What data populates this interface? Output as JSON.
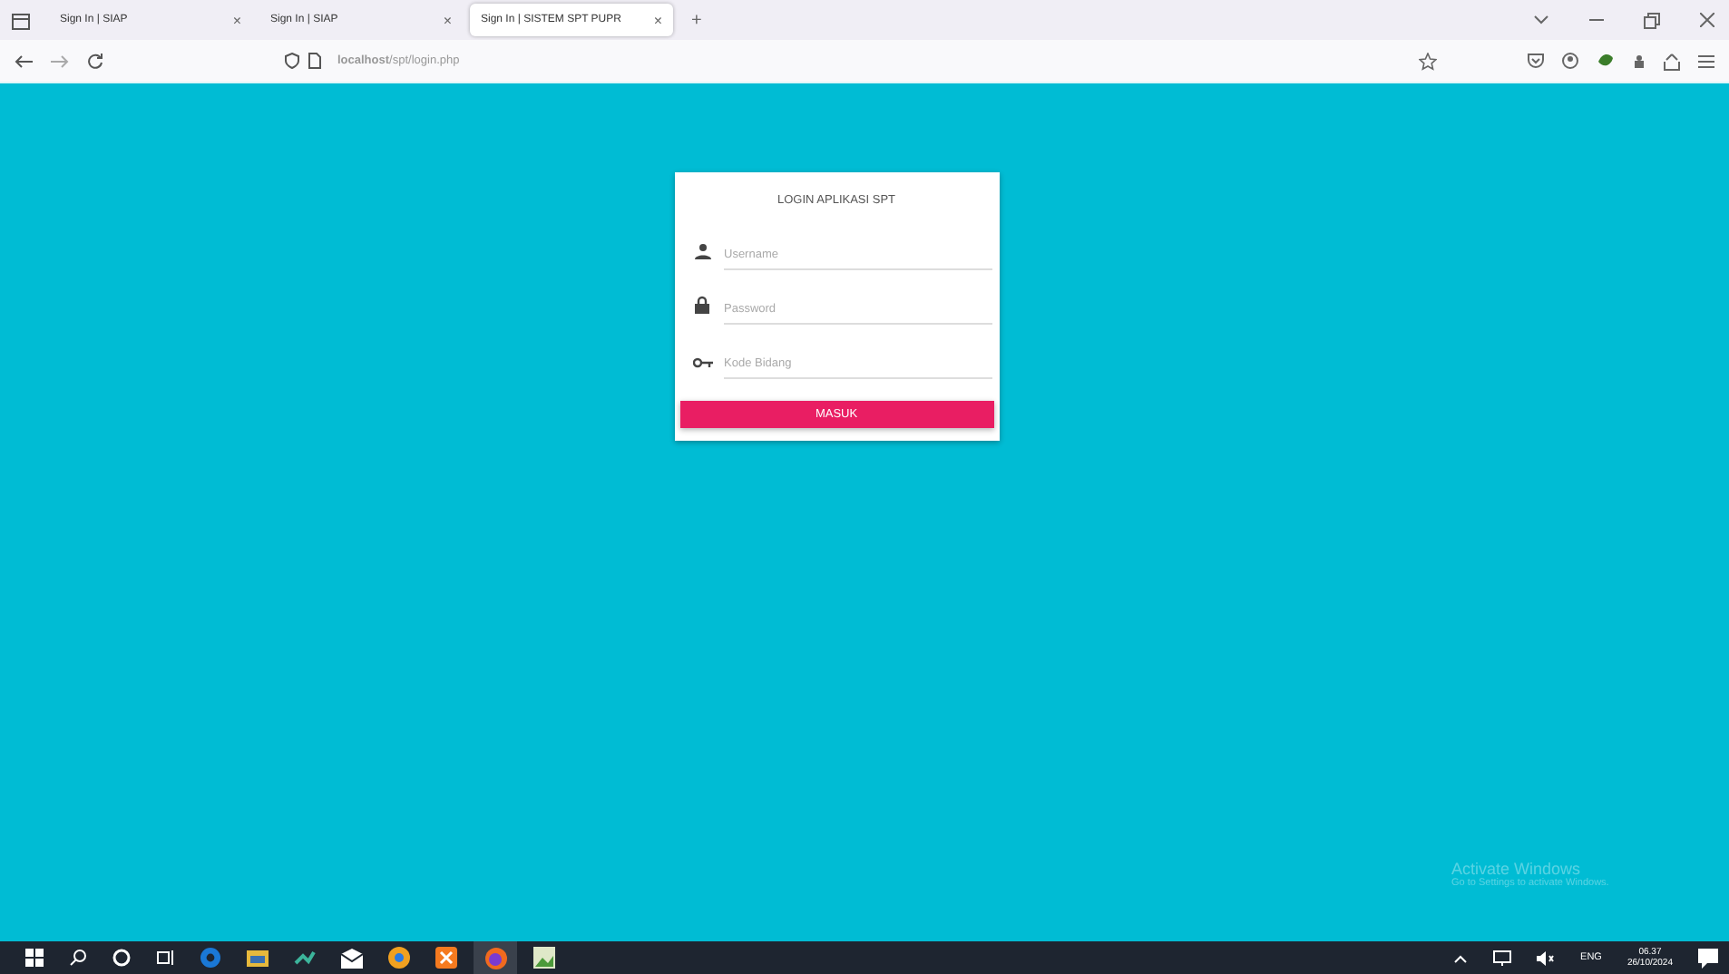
{
  "browser": {
    "tabs": [
      {
        "title": "Sign In | SIAP",
        "close": "×",
        "selected": false
      },
      {
        "title": "Sign In | SIAP",
        "close": "×",
        "selected": false
      },
      {
        "title": "Sign In | SISTEM SPT PUPR",
        "close": "×",
        "selected": true
      }
    ],
    "new_tab": "+",
    "url": "**localhost**/spt/login.php"
  },
  "login": {
    "title": "LOGIN APLIKASI SPT",
    "fields": [
      {
        "kind": "user",
        "placeholder": "Username"
      },
      {
        "kind": "lock",
        "placeholder": "Password"
      },
      {
        "kind": "key",
        "placeholder": "Kode Bidang"
      }
    ],
    "button": "MASUK"
  },
  "activation": {
    "title": "Activate Windows",
    "subtitle": "Go to Settings to activate Windows."
  },
  "taskbar": {
    "language": "ENG",
    "time": "06.37",
    "date": "26/10/2024"
  }
}
